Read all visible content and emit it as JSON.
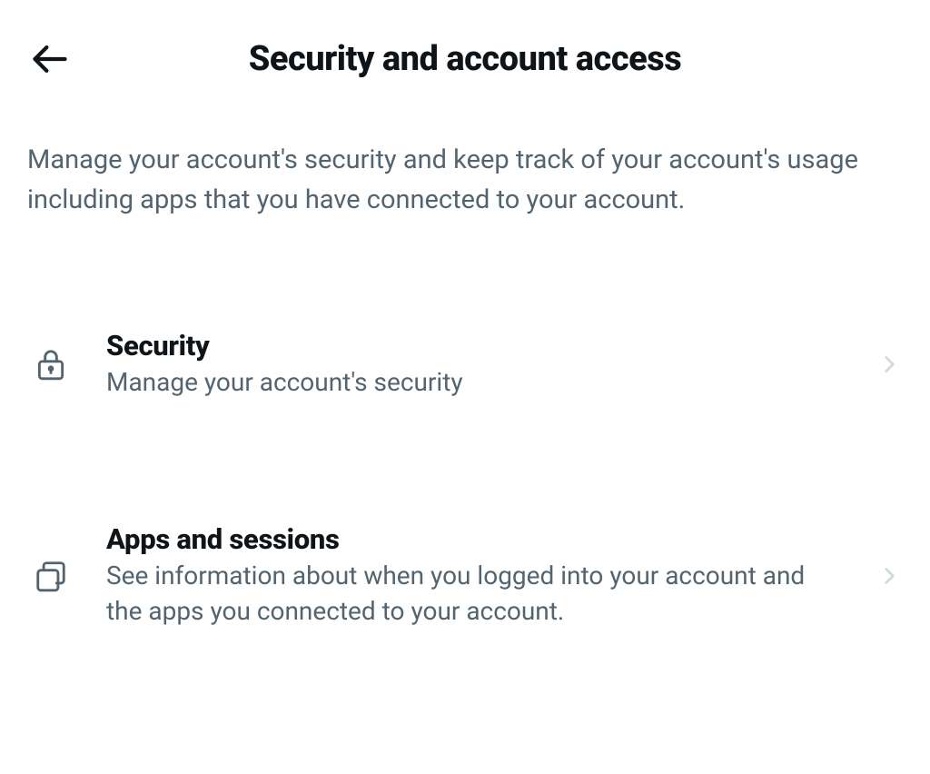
{
  "header": {
    "title": "Security and account access"
  },
  "description": "Manage your account's security and keep track of your account's usage including apps that you have connected to your account.",
  "items": [
    {
      "title": "Security",
      "subtitle": "Manage your account's security"
    },
    {
      "title": "Apps and sessions",
      "subtitle": "See information about when you logged into your account and the apps you connected to your account."
    }
  ]
}
